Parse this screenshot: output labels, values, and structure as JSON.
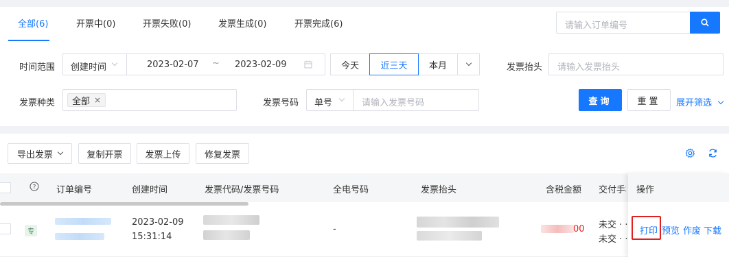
{
  "tabs": [
    {
      "label": "全部(6)",
      "active": true
    },
    {
      "label": "开票中(0)"
    },
    {
      "label": "开票失败(0)"
    },
    {
      "label": "发票生成(0)"
    },
    {
      "label": "开票完成(6)"
    }
  ],
  "search": {
    "placeholder": "请输入订单编号",
    "icon": "search-icon"
  },
  "filters": {
    "time_range_label": "时间范围",
    "time_type": "创建时间",
    "date_start": "2023-02-07",
    "date_sep": "~",
    "date_end": "2023-02-09",
    "quick_ranges": [
      "今天",
      "近三天",
      "本月"
    ],
    "quick_active": "近三天",
    "invoice_title_label": "发票抬头",
    "invoice_title_placeholder": "请输入发票抬头",
    "invoice_type_label": "发票种类",
    "invoice_type_tag": "全部",
    "invoice_no_label": "发票号码",
    "invoice_no_type": "单号",
    "invoice_no_placeholder": "请输入发票号码",
    "query_label": "查询",
    "reset_label": "重置",
    "expand_label": "展开筛选"
  },
  "toolbar": {
    "export_label": "导出发票",
    "copy_label": "复制开票",
    "upload_label": "发票上传",
    "repair_label": "修复发票",
    "settings_icon": "gear-icon",
    "refresh_icon": "refresh-icon"
  },
  "table": {
    "headers": [
      "订单编号",
      "创建时间",
      "发票代码/发票号码",
      "全电号码",
      "发票抬头",
      "含税金额",
      "交付手机",
      "操作"
    ],
    "rows": [
      {
        "badge": "专",
        "created_date": "2023-02-09",
        "created_time": "15:31:14",
        "all_elec_no": "-",
        "amount_suffix": "00",
        "delivery_1": "未交 · ·",
        "delivery_2": "未交 · ·",
        "actions": [
          "打印",
          "预览",
          "作废",
          "下载"
        ]
      }
    ]
  },
  "colors": {
    "accent": "#1677ff",
    "highlight_border": "#e02020",
    "amount": "#e02020"
  }
}
